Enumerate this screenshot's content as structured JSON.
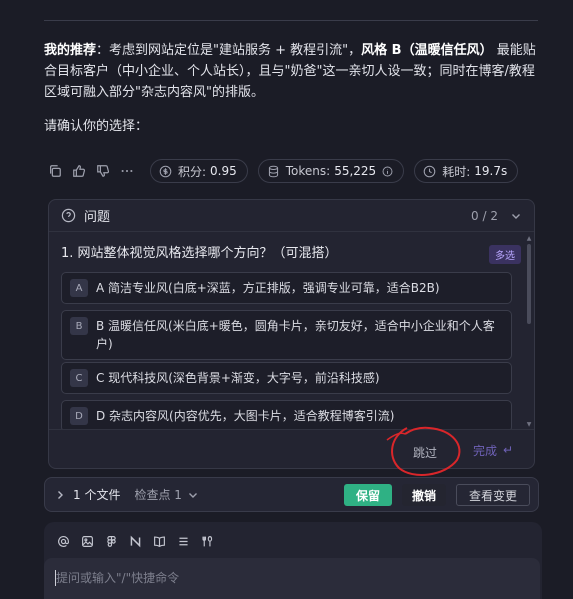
{
  "message": {
    "lead_bold": "我的推荐",
    "text1": "：考虑到网站定位是\"建站服务 + 教程引流\"，",
    "style_bold": "风格 B（温暖信任风）",
    "text2": " 最能贴合目标客户（中小企业、个人站长），且与\"奶爸\"这一亲切人设一致；同时在博客/教程区域可融入部分\"杂志内容风\"的排版。",
    "confirm": "请确认你的选择："
  },
  "stats": {
    "points_label": "积分:",
    "points_value": "0.95",
    "tokens_label": "Tokens:",
    "tokens_value": "55,225",
    "time_label": "耗时:",
    "time_value": "19.7s"
  },
  "question_panel": {
    "title": "问题",
    "count": "0 / 2",
    "question": "1. 网站整体视觉风格选择哪个方向？（可混搭）",
    "multi_badge": "多选",
    "options": [
      {
        "letter": "A",
        "text": "A 简洁专业风(白底+深蓝，方正排版，强调专业可靠，适合B2B)"
      },
      {
        "letter": "B",
        "text": "B 温暖信任风(米白底+暖色，圆角卡片，亲切友好，适合中小企业和个人客户)"
      },
      {
        "letter": "C",
        "text": "C 现代科技风(深色背景+渐变，大字号，前沿科技感)"
      },
      {
        "letter": "D",
        "text": "D 杂志内容风(内容优先，大图卡片，适合教程博客引流)"
      }
    ],
    "skip_label": "跳过",
    "done_label": "完成",
    "done_icon": "↵"
  },
  "changes_bar": {
    "files": "1 个文件",
    "checkpoint": "检查点 1",
    "keep": "保留",
    "undo": "撤销",
    "view": "查看变更"
  },
  "composer": {
    "placeholder": "提问或输入\"/\"快捷命令",
    "tool_icons": [
      "at-icon",
      "image-icon",
      "figma-icon",
      "network-icon",
      "book-icon",
      "list-icon",
      "tools-icon"
    ]
  },
  "colors": {
    "background": "#1b1c26",
    "accent_green": "#2fb184",
    "accent_purple": "#6f62b8",
    "annotation_red": "#d9262a"
  }
}
